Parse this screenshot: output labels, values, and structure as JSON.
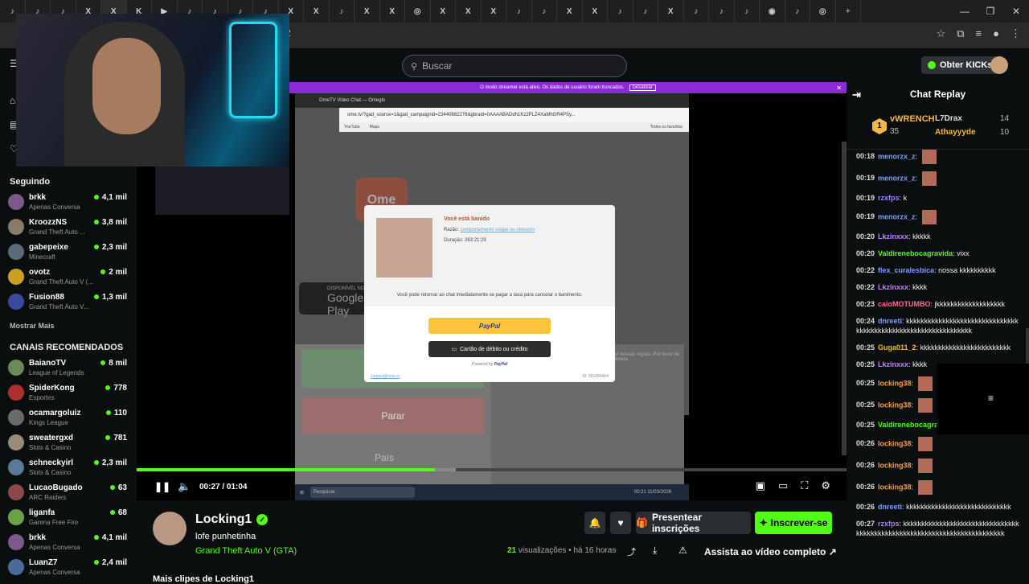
{
  "browser": {
    "tabs": [
      {
        "icon": "tiktok-icon",
        "glyph": "♪"
      },
      {
        "icon": "tiktok-icon",
        "glyph": "♪"
      },
      {
        "icon": "tiktok-icon",
        "glyph": "♪"
      },
      {
        "icon": "x-icon",
        "glyph": "X"
      },
      {
        "icon": "x-icon",
        "glyph": "X",
        "active": true
      },
      {
        "icon": "kick-icon",
        "glyph": "K"
      },
      {
        "icon": "youtube-icon",
        "glyph": "▶"
      },
      {
        "icon": "tiktok-icon",
        "glyph": "♪"
      },
      {
        "icon": "tiktok-icon",
        "glyph": "♪"
      },
      {
        "icon": "tiktok-icon",
        "glyph": "♪"
      },
      {
        "icon": "tiktok-icon",
        "glyph": "♪"
      },
      {
        "icon": "x-icon",
        "glyph": "X"
      },
      {
        "icon": "x-icon",
        "glyph": "X"
      },
      {
        "icon": "tiktok-icon",
        "glyph": "♪"
      },
      {
        "icon": "x-icon",
        "glyph": "X"
      },
      {
        "icon": "x-icon",
        "glyph": "X"
      },
      {
        "icon": "instagram-icon",
        "glyph": "◎"
      },
      {
        "icon": "x-icon",
        "glyph": "X"
      },
      {
        "icon": "x-icon",
        "glyph": "X"
      },
      {
        "icon": "x-icon",
        "glyph": "X"
      },
      {
        "icon": "tiktok-icon",
        "glyph": "♪"
      },
      {
        "icon": "tiktok-icon",
        "glyph": "♪"
      },
      {
        "icon": "x-icon",
        "glyph": "X"
      },
      {
        "icon": "x-icon",
        "glyph": "X"
      },
      {
        "icon": "tiktok-icon",
        "glyph": "♪"
      },
      {
        "icon": "tiktok-icon",
        "glyph": "♪"
      },
      {
        "icon": "x-icon",
        "glyph": "X"
      },
      {
        "icon": "tiktok-icon",
        "glyph": "♪"
      },
      {
        "icon": "tiktok-icon",
        "glyph": "♪"
      },
      {
        "icon": "tiktok-icon",
        "glyph": "♪"
      },
      {
        "icon": "chrome-icon",
        "glyph": "◉"
      },
      {
        "icon": "tiktok-icon",
        "glyph": "♪"
      },
      {
        "icon": "instagram-icon",
        "glyph": "◎"
      }
    ],
    "new_tab": "+",
    "address_fragment": "2"
  },
  "header": {
    "search_placeholder": "Buscar",
    "get_kicks": "Obter KICKs"
  },
  "sidebar": {
    "following_title": "Seguindo",
    "following": [
      {
        "name": "brkk",
        "category": "Apenas Conversa",
        "viewers": "4,1 mil",
        "color": "#7a5a8a"
      },
      {
        "name": "KroozzNS",
        "category": "Grand Theft Auto ...",
        "viewers": "3,8 mil",
        "color": "#8a7a6a"
      },
      {
        "name": "gabepeixe",
        "category": "Minecraft",
        "viewers": "2,3 mil",
        "color": "#5a6a7a"
      },
      {
        "name": "ovotz",
        "category": "Grand Theft Auto V (...",
        "viewers": "2 mil",
        "color": "#c9a020"
      },
      {
        "name": "Fusion88",
        "category": "Grand Theft Auto V...",
        "viewers": "1,3 mil",
        "color": "#3a4aa0"
      }
    ],
    "show_more": "Mostrar Mais",
    "recommended_title": "CANAIS RECOMENDADOS",
    "recommended": [
      {
        "name": "BaianoTV",
        "category": "League of Legends",
        "viewers": "8 mil",
        "color": "#6a8a5a"
      },
      {
        "name": "SpiderKong",
        "category": "Esportes",
        "viewers": "778",
        "color": "#b03030"
      },
      {
        "name": "ocamargoluiz",
        "category": "Kings League",
        "viewers": "110",
        "color": "#6a6a6a"
      },
      {
        "name": "sweatergxd",
        "category": "Slots & Casino",
        "viewers": "781",
        "color": "#9a8a7a"
      },
      {
        "name": "schneckyirl",
        "category": "Slots & Casino",
        "viewers": "2,3 mil",
        "color": "#5a7a9a"
      },
      {
        "name": "LucaoBugado",
        "category": "ARC Raiders",
        "viewers": "63",
        "color": "#8a4a4a"
      },
      {
        "name": "liganfa",
        "category": "Garena Free Fire",
        "viewers": "68",
        "color": "#6aa04a"
      },
      {
        "name": "brkk",
        "category": "Apenas Conversa",
        "viewers": "4,1 mil",
        "color": "#7a5a8a"
      },
      {
        "name": "LuanZ7",
        "category": "Apenas Conversa",
        "viewers": "2,4 mil",
        "color": "#4a6a9a"
      }
    ]
  },
  "video": {
    "banner_text": "O modo streamer está ativo. Os dados de usuário foram truncados.",
    "banner_button": "Desativar",
    "inner_tab": "OmeTV Video Chat — Omeglo",
    "inner_url": "ome.tv/?gad_source=1&gad_campaignid=23440882276&gbraid=0AAAABADdh1Kz2PLZ4XaMhGR4PSy...",
    "bookmarks": [
      "YouTube",
      "Maps"
    ],
    "bookmarks_right": "Todos os favoritos",
    "logo": "Ome",
    "play_store_small": "DISPONÍVEL NO",
    "play_store": "Google Play",
    "stop_label": "Parar",
    "country_label": "País",
    "right_panel_text": "Ler nossas\nregras. Por\nfavor de câmera",
    "modal": {
      "title": "Você está banido",
      "reason_label": "Razão:",
      "reason_link": "comportamento vulgar ou obsceno",
      "duration": "Duração: 263:21:29",
      "message": "Você pode retornar ao chat imediatamente se pagar a taxa para cancelar o banimento.",
      "paypal": "PayPal",
      "card": "Cartão de débito ou crédito",
      "powered": "Powered by",
      "powered_brand": "PayPal",
      "contact": "contact@ome.tv",
      "id": "ID: 561456464"
    },
    "taskbar_search": "Pesquisar",
    "taskbar_clock": "00:21\n11/03/2026",
    "time": "00:27 / 01:04",
    "progress": 0.42,
    "buffered": 0.45
  },
  "clip": {
    "streamer": "Locking1",
    "title": "lofe punhetinha",
    "game": "Grand Theft Auto V (GTA)",
    "gift_label": "Presentear inscrições",
    "subscribe_label": "Inscrever-se",
    "views_count": "21",
    "views_label": "visualizações",
    "time_ago": "• há 16 horas",
    "full_video": "Assista ao vídeo completo",
    "more_clips": "Mais clipes de Locking1"
  },
  "chat": {
    "title": "Chat Replay",
    "leader1": {
      "name": "vWRENCH",
      "count": "35"
    },
    "leader2": {
      "name": "L7Drax",
      "count": "14"
    },
    "leader3": {
      "name": "Athayyyde",
      "count": "10"
    },
    "messages": [
      {
        "time": "00:18",
        "user": "menorzx_z",
        "color": "#7aa0ff",
        "text": "",
        "emote": true
      },
      {
        "time": "00:19",
        "user": "menorzx_z",
        "color": "#7aa0ff",
        "text": "",
        "emote": true
      },
      {
        "time": "00:19",
        "user": "rzxfps",
        "color": "#a080ff",
        "text": "k"
      },
      {
        "time": "00:19",
        "user": "menorzx_z",
        "color": "#7aa0ff",
        "text": "",
        "emote": true
      },
      {
        "time": "00:20",
        "user": "Lkzinxxx",
        "color": "#c080ff",
        "text": "kkkkk"
      },
      {
        "time": "00:20",
        "user": "Valdirenebocagravida",
        "color": "#53fc18",
        "text": "vixx"
      },
      {
        "time": "00:22",
        "user": "flex_curalesbica",
        "color": "#7aa0ff",
        "text": "nossa kkkkkkkkkk"
      },
      {
        "time": "00:22",
        "user": "Lkzinxxx",
        "color": "#c080ff",
        "text": "kkkk"
      },
      {
        "time": "00:23",
        "user": "caioMOTUMBO",
        "color": "#ff6a8a",
        "text": "jkkkkkkkkkkkkkkkkkkk"
      },
      {
        "time": "00:24",
        "user": "dnreeti",
        "color": "#7aa0ff",
        "text": "kkkkkkkkkkkkkkkkkkkkkkkkkkkkkkkkkkkkkkkkkkkkkkkkkkkkkkkkkkkkkkk"
      },
      {
        "time": "00:25",
        "user": "Guga011_2",
        "color": "#f5b942",
        "text": "kkkkkkkkkkkkkkkkkkkkkkkkk"
      },
      {
        "time": "00:25",
        "user": "Lkzinxxx",
        "color": "#c080ff",
        "text": "kkkk"
      },
      {
        "time": "00:25",
        "user": "locking38",
        "color": "#ff9a3a",
        "text": "",
        "emote": true
      },
      {
        "time": "00:25",
        "user": "locking38",
        "color": "#ff9a3a",
        "text": "",
        "emote": true
      },
      {
        "time": "00:25",
        "user": "Valdirenebocagravida",
        "color": "#53fc18",
        "text": "okkkkk"
      },
      {
        "time": "00:26",
        "user": "locking38",
        "color": "#ff9a3a",
        "text": "",
        "emote": true
      },
      {
        "time": "00:26",
        "user": "locking38",
        "color": "#ff9a3a",
        "text": "",
        "emote": true
      },
      {
        "time": "00:26",
        "user": "locking38",
        "color": "#ff9a3a",
        "text": "",
        "emote": true
      },
      {
        "time": "00:26",
        "user": "dnreeti",
        "color": "#7aa0ff",
        "text": "kkkkkkkkkkkkkkkkkkkkkkkkkkkkk"
      },
      {
        "time": "00:27",
        "user": "rzxfps",
        "color": "#a080ff",
        "text": "kkkkkkkkkkkkkkkkkkkkkkkkkkkkkkkkkkkkkkkkkkkkkkkkkkkkkkkkkkkkkkkkkkkkkkkkk"
      }
    ]
  }
}
